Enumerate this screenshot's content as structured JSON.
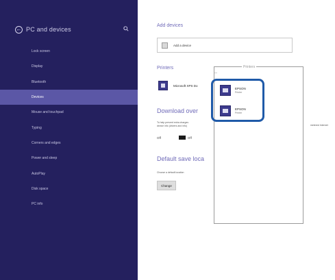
{
  "sidebar": {
    "title": "PC and devices",
    "items": [
      {
        "label": "Lock screen",
        "active": false
      },
      {
        "label": "Display",
        "active": false
      },
      {
        "label": "Bluetooth",
        "active": false
      },
      {
        "label": "Devices",
        "active": true
      },
      {
        "label": "Mouse and touchpad",
        "active": false
      },
      {
        "label": "Typing",
        "active": false
      },
      {
        "label": "Corners and edges",
        "active": false
      },
      {
        "label": "Power and sleep",
        "active": false
      },
      {
        "label": "AutoPlay",
        "active": false
      },
      {
        "label": "Disk space",
        "active": false
      },
      {
        "label": "PC info",
        "active": false
      }
    ]
  },
  "main": {
    "add_devices_title": "Add devices",
    "add_device_label": "Add a device",
    "printers_title": "Printers",
    "printer_name": "Microsoft XPS Do",
    "download_title": "Download over",
    "download_desc_line1": "To help prevent extra charges",
    "download_desc_line2": "device info (drivers and info)",
    "download_desc_tail": "metered Internet",
    "toggle_state": "Off",
    "default_title": "Default save loca",
    "default_desc": "Choose a default location",
    "change_button": "Change"
  },
  "flyout": {
    "header": "Printers",
    "items": [
      {
        "name": "EPSON",
        "sub": "Printer"
      },
      {
        "name": "EPSON",
        "sub": "Printer"
      }
    ]
  },
  "colors": {
    "sidebar_bg": "#24205e",
    "sidebar_active": "#5b57a6",
    "accent_title": "#6f6ab8",
    "highlight": "#1f5aa8"
  }
}
